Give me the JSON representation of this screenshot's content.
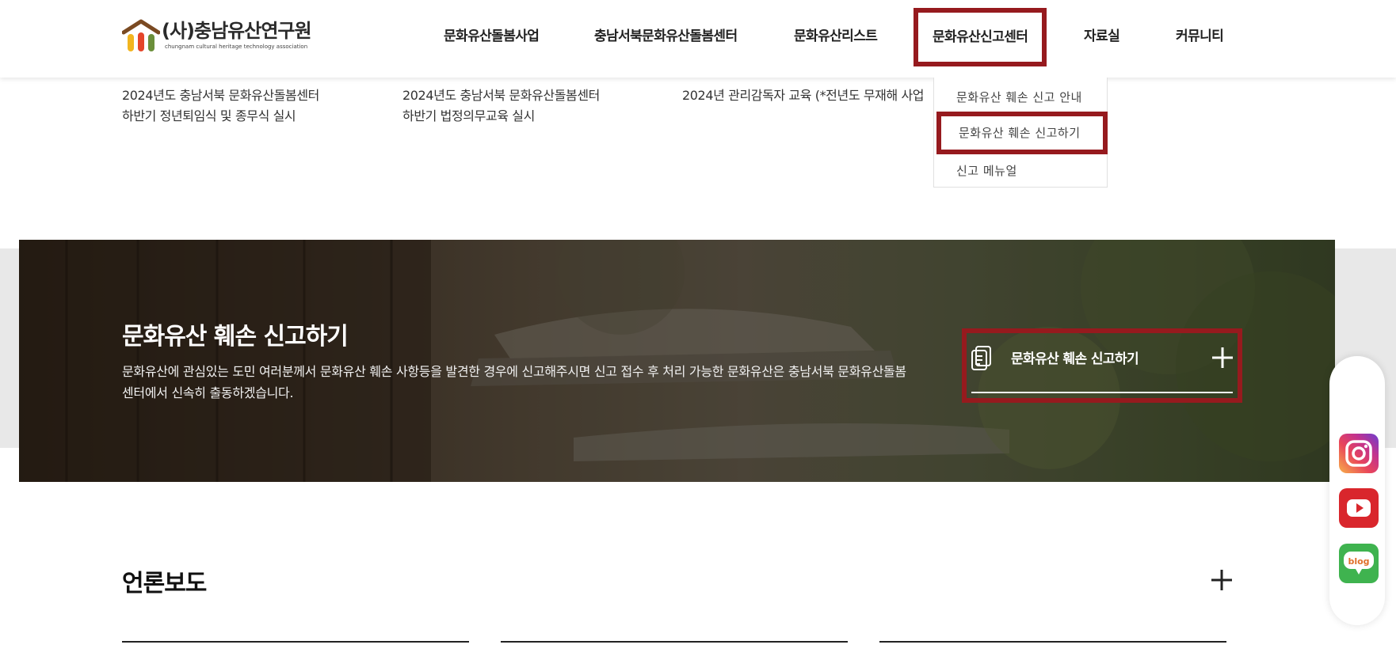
{
  "header": {
    "logo_title": "(사)충남유산연구원",
    "logo_subtitle": "chungnam cultural heritage technology association",
    "nav": [
      "문화유산돌봄사업",
      "충남서북문화유산돌봄센터",
      "문화유산리스트",
      "문화유산신고센터",
      "자료실",
      "커뮤니티"
    ],
    "active_nav": "문화유산신고센터"
  },
  "dropdown": {
    "items": [
      "문화유산 훼손 신고 안내",
      "문화유산 훼손 신고하기",
      "신고 메뉴얼"
    ],
    "highlighted": "문화유산 훼손 신고하기"
  },
  "news": [
    {
      "line1": "2024년도 충남서북 문화유산돌봄센터",
      "line2": "하반기 정년퇴임식 및 종무식 실시"
    },
    {
      "line1": "2024년도 충남서북 문화유산돌봄센터",
      "line2": "하반기 법정의무교육 실시"
    },
    {
      "line1": "2024년 관리감독자 교육 (*전년도 무재해 사업",
      "line2": ""
    }
  ],
  "banner": {
    "title": "문화유산 훼손 신고하기",
    "description": "문화유산에 관심있는 도민 여러분께서 문화유산 훼손 사항등을 발견한 경우에 신고해주시면 신고 접수 후 처리 가능한 문화유산은 충남서북 문화유산돌봄센터에서 신속히 출동하겠습니다.",
    "button_label": "문화유산 훼손 신고하기",
    "button_icon": "document-icon"
  },
  "press": {
    "title": "언론보도"
  },
  "sns": {
    "icons": [
      "instagram-icon",
      "youtube-icon",
      "blog-icon"
    ],
    "blog_text": "blog"
  },
  "colors": {
    "highlight_border": "#961a1e",
    "instagram": "#e9465a",
    "youtube": "#d9262c",
    "blog": "#3fb34f"
  }
}
